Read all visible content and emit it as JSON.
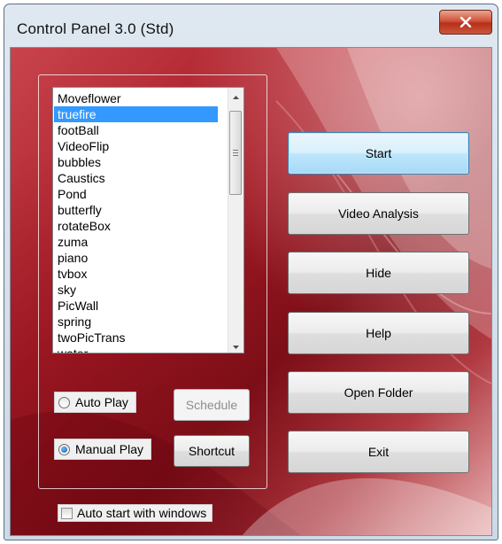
{
  "window": {
    "title": "Control Panel 3.0 (Std)"
  },
  "titlebar": {
    "close_icon": "close-icon"
  },
  "effects_list": {
    "items": [
      "Moveflower",
      "truefire",
      "footBall",
      "VideoFlip",
      "bubbles",
      "Caustics",
      "Pond",
      "butterfly",
      "rotateBox",
      "zuma",
      "piano",
      "tvbox",
      "sky",
      "PicWall",
      "spring",
      "twoPicTrans",
      "water"
    ],
    "selected": "truefire"
  },
  "play_mode": {
    "auto_play_label": "Auto Play",
    "manual_play_label": "Manual Play",
    "selected": "Manual Play"
  },
  "buttons": {
    "schedule": "Schedule",
    "shortcut": "Shortcut",
    "start": "Start",
    "video_analysis": "Video Analysis",
    "hide": "Hide",
    "help": "Help",
    "open_folder": "Open Folder",
    "exit": "Exit"
  },
  "options": {
    "auto_start_label": "Auto start with windows",
    "auto_start_checked": false
  },
  "colors": {
    "selection": "#3399ff",
    "background_red": "#a81b26",
    "close_button": "#c9412a"
  }
}
